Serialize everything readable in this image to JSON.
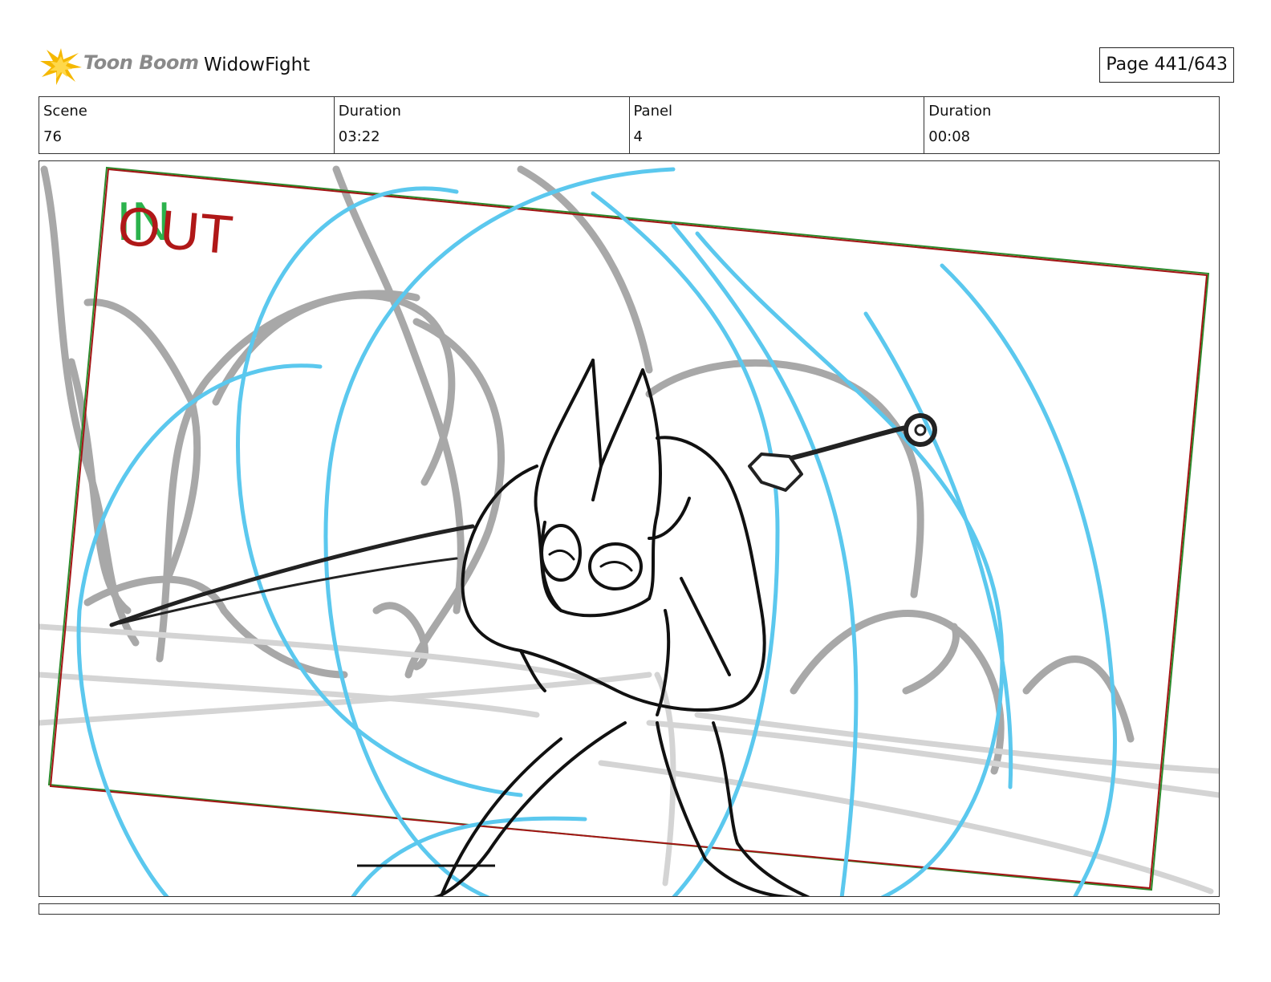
{
  "header": {
    "brand": "Toon Boom",
    "project_title": "WidowFight",
    "page_label": "Page 441/643"
  },
  "info": {
    "scene_label": "Scene",
    "scene_value": "76",
    "scene_duration_label": "Duration",
    "scene_duration_value": "03:22",
    "panel_label": "Panel",
    "panel_value": "4",
    "panel_duration_label": "Duration",
    "panel_duration_value": "00:08"
  },
  "panel": {
    "marker_in": "IN",
    "marker_out": "OUT"
  },
  "colors": {
    "camera_frame": "#a31515",
    "in_marker": "#2bb24c",
    "out_marker": "#b01818",
    "effects_lines": "#5bc8ee",
    "background_sketch": "#a8a8a8",
    "character_ink": "#111111",
    "logo_star": "#f5b800"
  }
}
